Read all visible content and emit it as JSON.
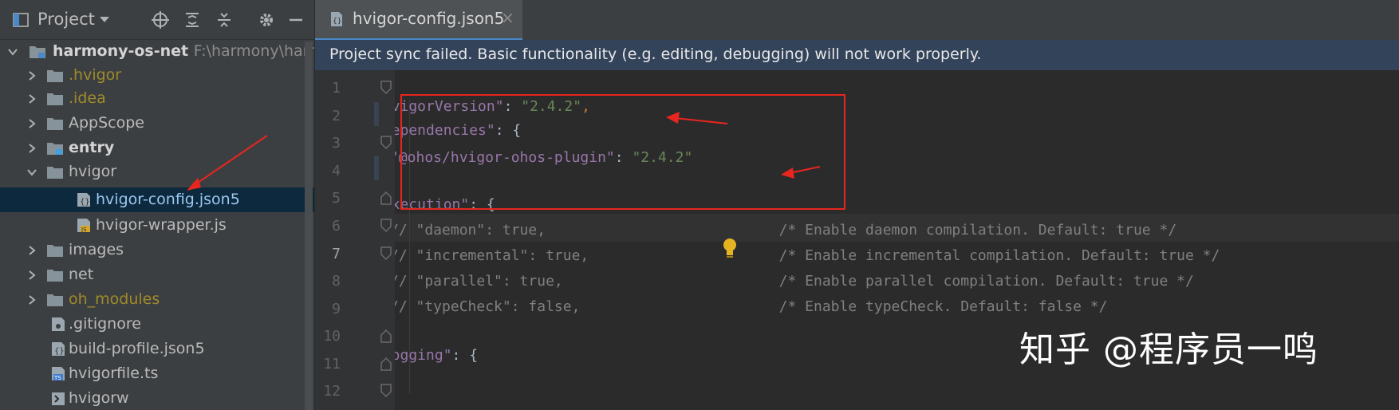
{
  "project_panel": {
    "title": "Project",
    "tree": [
      {
        "label": "harmony-os-net",
        "path": "F:\\harmony\\harmo",
        "type": "module-root",
        "expanded": true,
        "bold": true
      },
      {
        "label": ".hvigor",
        "type": "folder",
        "color": "olive"
      },
      {
        "label": ".idea",
        "type": "folder",
        "color": "olive"
      },
      {
        "label": "AppScope",
        "type": "folder"
      },
      {
        "label": "entry",
        "type": "module-folder",
        "bold": true
      },
      {
        "label": "hvigor",
        "type": "folder",
        "expanded": true
      },
      {
        "label": "hvigor-config.json5",
        "type": "json5-file",
        "selected": true
      },
      {
        "label": "hvigor-wrapper.js",
        "type": "js-file"
      },
      {
        "label": "images",
        "type": "folder"
      },
      {
        "label": "net",
        "type": "folder"
      },
      {
        "label": "oh_modules",
        "type": "folder",
        "color": "olive"
      },
      {
        "label": ".gitignore",
        "type": "config-file"
      },
      {
        "label": "build-profile.json5",
        "type": "json5-file"
      },
      {
        "label": "hvigorfile.ts",
        "type": "ts-file"
      },
      {
        "label": "hvigorw",
        "type": "shell-file"
      }
    ]
  },
  "editor": {
    "tab_label": "hvigor-config.json5",
    "tab_close": "×",
    "banner": "Project sync failed. Basic functionality (e.g. editing, debugging) will not work properly.",
    "current_line": 7,
    "line_numbers": [
      "1",
      "2",
      "3",
      "4",
      "5",
      "6",
      "7",
      "8",
      "9",
      "10",
      "11",
      "12"
    ]
  },
  "watermark": "知乎 @程序员一鸣",
  "colors": {
    "accent": "#4a88c7",
    "annotation": "#e8251f",
    "banner_bg": "#32435a",
    "selection_bg": "#0d293e"
  }
}
